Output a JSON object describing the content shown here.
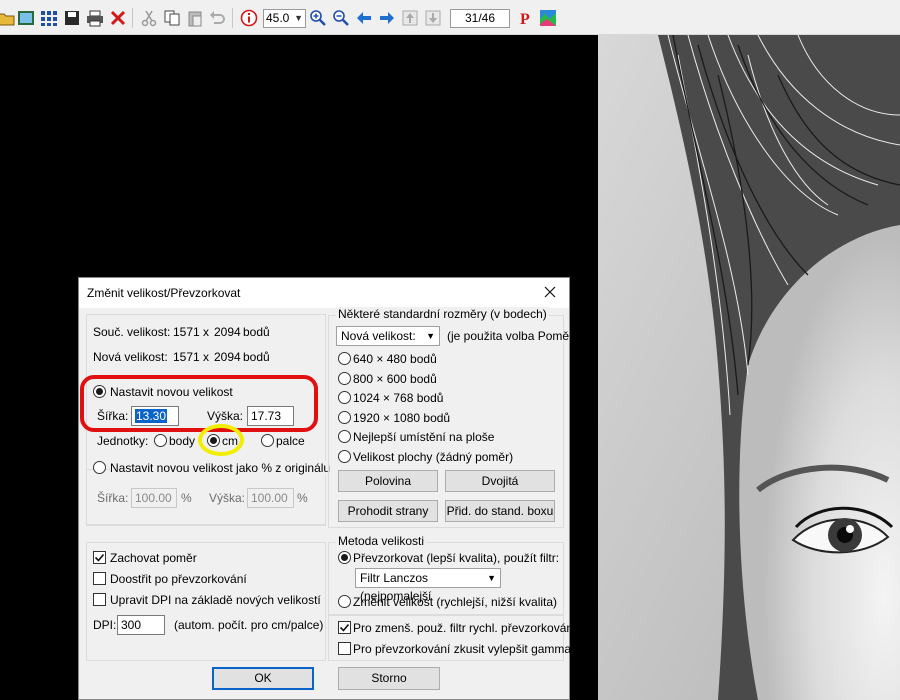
{
  "toolbar": {
    "zoom_value": "45.0",
    "page_counter": "31/46",
    "icons": [
      "open-folder-icon",
      "thumbnail-view-icon",
      "grid-view-icon",
      "save-icon",
      "print-icon",
      "delete-icon",
      "cut-icon",
      "copy-icon",
      "paste-icon",
      "undo-icon",
      "info-icon",
      "zoom-in-icon",
      "zoom-out-icon",
      "previous-icon",
      "next-icon",
      "first-page-icon",
      "last-page-icon",
      "pdf-p-icon",
      "palette-icon"
    ]
  },
  "dialog": {
    "title": "Změnit velikost/Převzorkovat",
    "current_size": {
      "label": "Souč. velikost:",
      "width": "1571",
      "x": "x",
      "height": "2094",
      "unit": "bodů"
    },
    "new_size": {
      "label": "Nová velikost:",
      "width": "1571",
      "x": "x",
      "height": "2094",
      "unit": "bodů"
    },
    "set_new_size": {
      "label": "Nastavit novou velikost",
      "width_label": "Šířka:",
      "width_value": "13.30",
      "height_label": "Výška:",
      "height_value": "17.73"
    },
    "units": {
      "label": "Jednotky:",
      "options": [
        "body",
        "cm",
        "palce"
      ],
      "selected": "cm"
    },
    "percent": {
      "label": "Nastavit novou velikost jako % z originálu",
      "width_label": "Šířka:",
      "width_value": "100.00",
      "height_label": "Výška:",
      "height_value": "100.00",
      "unit": "%"
    },
    "options": {
      "keep_ratio": "Zachovat poměr",
      "sharpen": "Doostřit po převzorkování",
      "adjust_dpi": "Upravit DPI na základě nových velikostí",
      "dpi_label": "DPI:",
      "dpi_value": "300",
      "dpi_note": "(autom. počít. pro cm/palce)"
    },
    "standard": {
      "title": "Některé standardní rozměry (v bodech)",
      "dropdown_value": "Nová velikost:",
      "dropdown_note": "(je použita volba Poměr)",
      "sizes": [
        "640 × 480 bodů",
        "800 × 600 bodů",
        "1024 × 768 bodů",
        "1920 × 1080 bodů",
        "Nejlepší umístění na ploše",
        "Velikost plochy (žádný poměr)"
      ],
      "half_button": "Polovina",
      "double_button": "Dvojitá",
      "swap_button": "Prohodit strany",
      "fit_box_button": "Přid. do stand. boxu"
    },
    "method": {
      "title": "Metoda velikosti",
      "resample_label": "Převzorkovat (lepší kvalita), použít filtr:",
      "filter_value": "Filtr Lanczos (nejpomalejší",
      "resize_label": "Změnit velikost (rychlejší, nižší kvalita)",
      "fast_filter_label": "Pro zmenš. použ. filtr rychl. převzorkování",
      "gamma_label": "Pro převzorkování zkusit vylepšit gamma"
    },
    "ok_button": "OK",
    "cancel_button": "Storno"
  }
}
